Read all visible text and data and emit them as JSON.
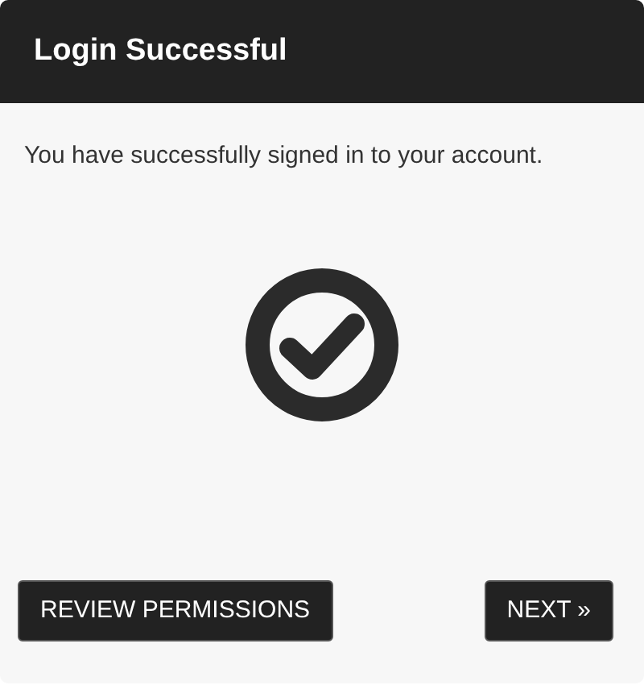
{
  "dialog": {
    "title": "Login Successful",
    "message": "You have successfully signed in to your account.",
    "buttons": [
      {
        "label": "REVIEW PERMISSIONS"
      },
      {
        "label": "NEXT »"
      }
    ]
  }
}
